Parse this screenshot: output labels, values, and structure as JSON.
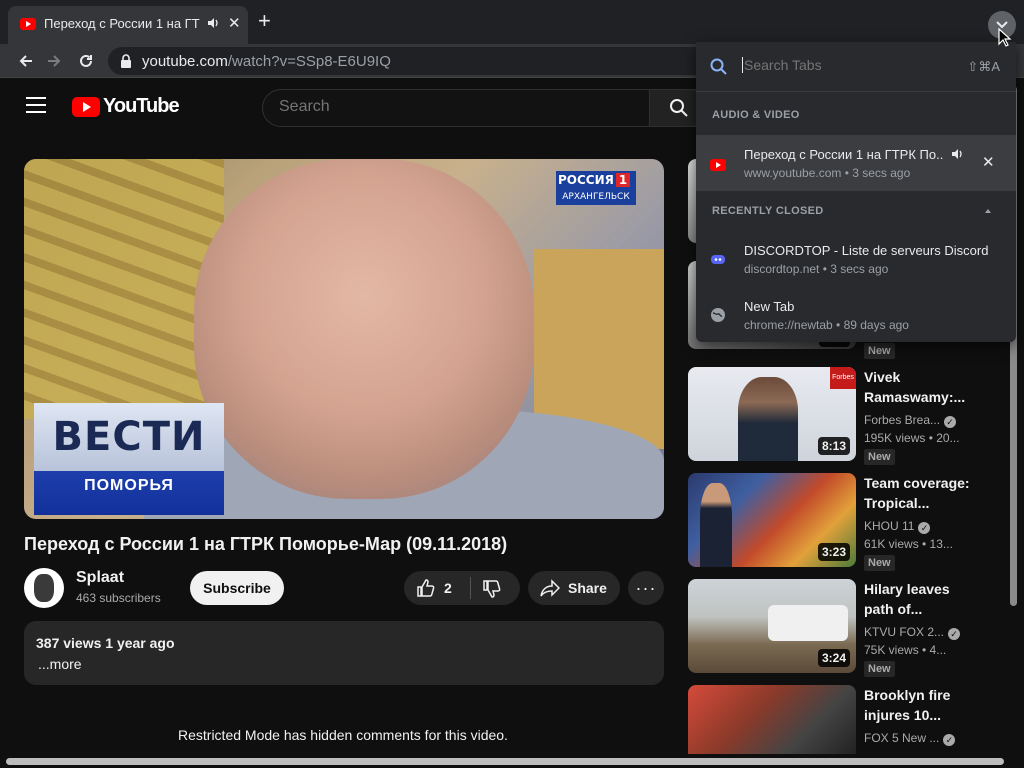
{
  "browser": {
    "tab_title": "Переход с России 1 на ГТРК Поморье-Мар (09.11.2018)",
    "url_host": "youtube.com",
    "url_path": "/watch?v=SSp8-E6U9IQ"
  },
  "youtube": {
    "logo_text": "YouTube",
    "search_placeholder": "Search"
  },
  "video": {
    "title": "Переход с России 1 на ГТРК Поморье-Мар (09.11.2018)",
    "vesti_top": "ВЕСТИ",
    "vesti_bottom": "ПОМОРЬЯ",
    "channel_logo_line1": "РОССИЯ",
    "channel_logo_num": "1",
    "channel_logo_line2": "АРХАНГЕЛЬСК"
  },
  "channel": {
    "name": "Splaat",
    "subscribers": "463 subscribers",
    "subscribe_label": "Subscribe"
  },
  "actions": {
    "likes": "2",
    "share_label": "Share",
    "more_glyph": "···"
  },
  "description": {
    "meta": "387 views  1 year ago",
    "more": "...more"
  },
  "comments_notice": "Restricted Mode has hidden comments for this video.",
  "recommendations": [
    {
      "title": "Vivek Ramaswamy:...",
      "channel": "Forbes Brea...",
      "views": "195K views  • 20...",
      "badge": "New",
      "duration": "8:13"
    },
    {
      "title": "Team coverage: Tropical...",
      "channel": "KHOU 11",
      "views": "61K views  • 13...",
      "badge": "New",
      "duration": "3:23"
    },
    {
      "title": "Hilary leaves path of...",
      "channel": "KTVU FOX 2...",
      "views": "75K views  • 4...",
      "badge": "New",
      "duration": "3:24"
    },
    {
      "title": "Brooklyn fire injures 10...",
      "channel": "FOX 5 New ...",
      "views": "",
      "badge": "",
      "duration": ""
    }
  ],
  "partial_badge": "New",
  "tab_search": {
    "placeholder": "Search Tabs",
    "shortcut": "⇧⌘A",
    "section_audio": "AUDIO & VIDEO",
    "section_recent": "RECENTLY CLOSED",
    "audio_items": [
      {
        "title": "Переход с России 1 на ГТРК По...",
        "subtitle": "www.youtube.com • 3 secs ago"
      }
    ],
    "recent_items": [
      {
        "title": "DISCORDTOP - Liste de serveurs Discord",
        "subtitle": "discordtop.net • 3 secs ago"
      },
      {
        "title": "New Tab",
        "subtitle": "chrome://newtab • 89 days ago"
      }
    ]
  },
  "colors": {
    "youtube_red": "#ff0000",
    "page_bg": "#0f0f0f",
    "popup_bg": "#292a2d",
    "accent_blue": "#8ab4f8",
    "discord": "#5865f2"
  }
}
